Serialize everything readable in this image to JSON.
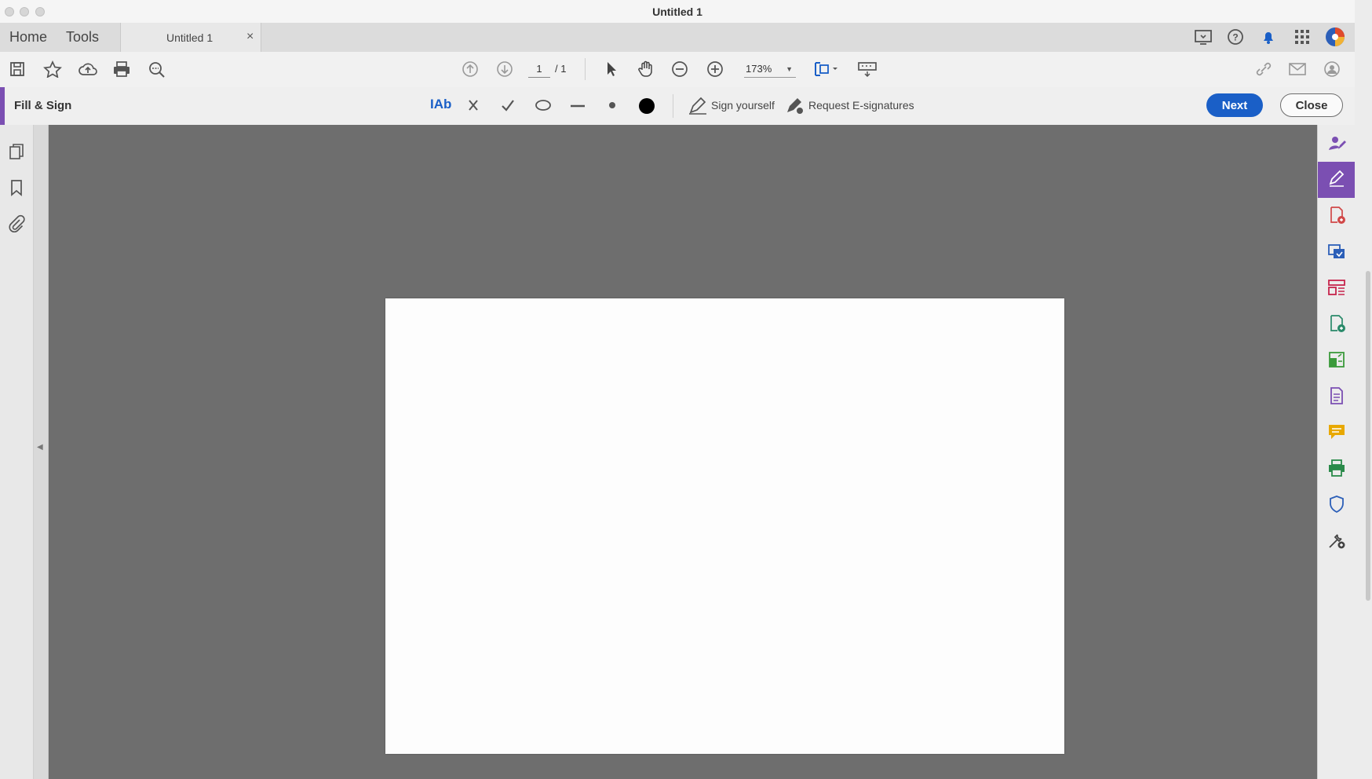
{
  "window": {
    "title": "Untitled 1"
  },
  "tabbar": {
    "home": "Home",
    "tools": "Tools",
    "doc_tab": "Untitled 1",
    "close_tab": "×"
  },
  "toolbar": {
    "page_current": "1",
    "page_total": "/ 1",
    "zoom": "173%"
  },
  "fill_sign": {
    "title": "Fill & Sign",
    "text_tool": "IAb",
    "sign_yourself": "Sign yourself",
    "request_esign": "Request E-signatures",
    "next": "Next",
    "close": "Close"
  },
  "colors": {
    "accent_purple": "#7b4fb2",
    "primary_blue": "#1a5fc7",
    "canvas_gray": "#6e6e6e"
  },
  "right_rail_icons": [
    "fill-sign-user-icon",
    "fill-sign-pen-icon",
    "export-pdf-icon",
    "edit-pdf-icon",
    "organize-pages-icon",
    "create-pdf-icon",
    "compress-icon",
    "combine-icon",
    "comment-icon",
    "print-production-icon",
    "protect-icon",
    "more-tools-icon"
  ]
}
